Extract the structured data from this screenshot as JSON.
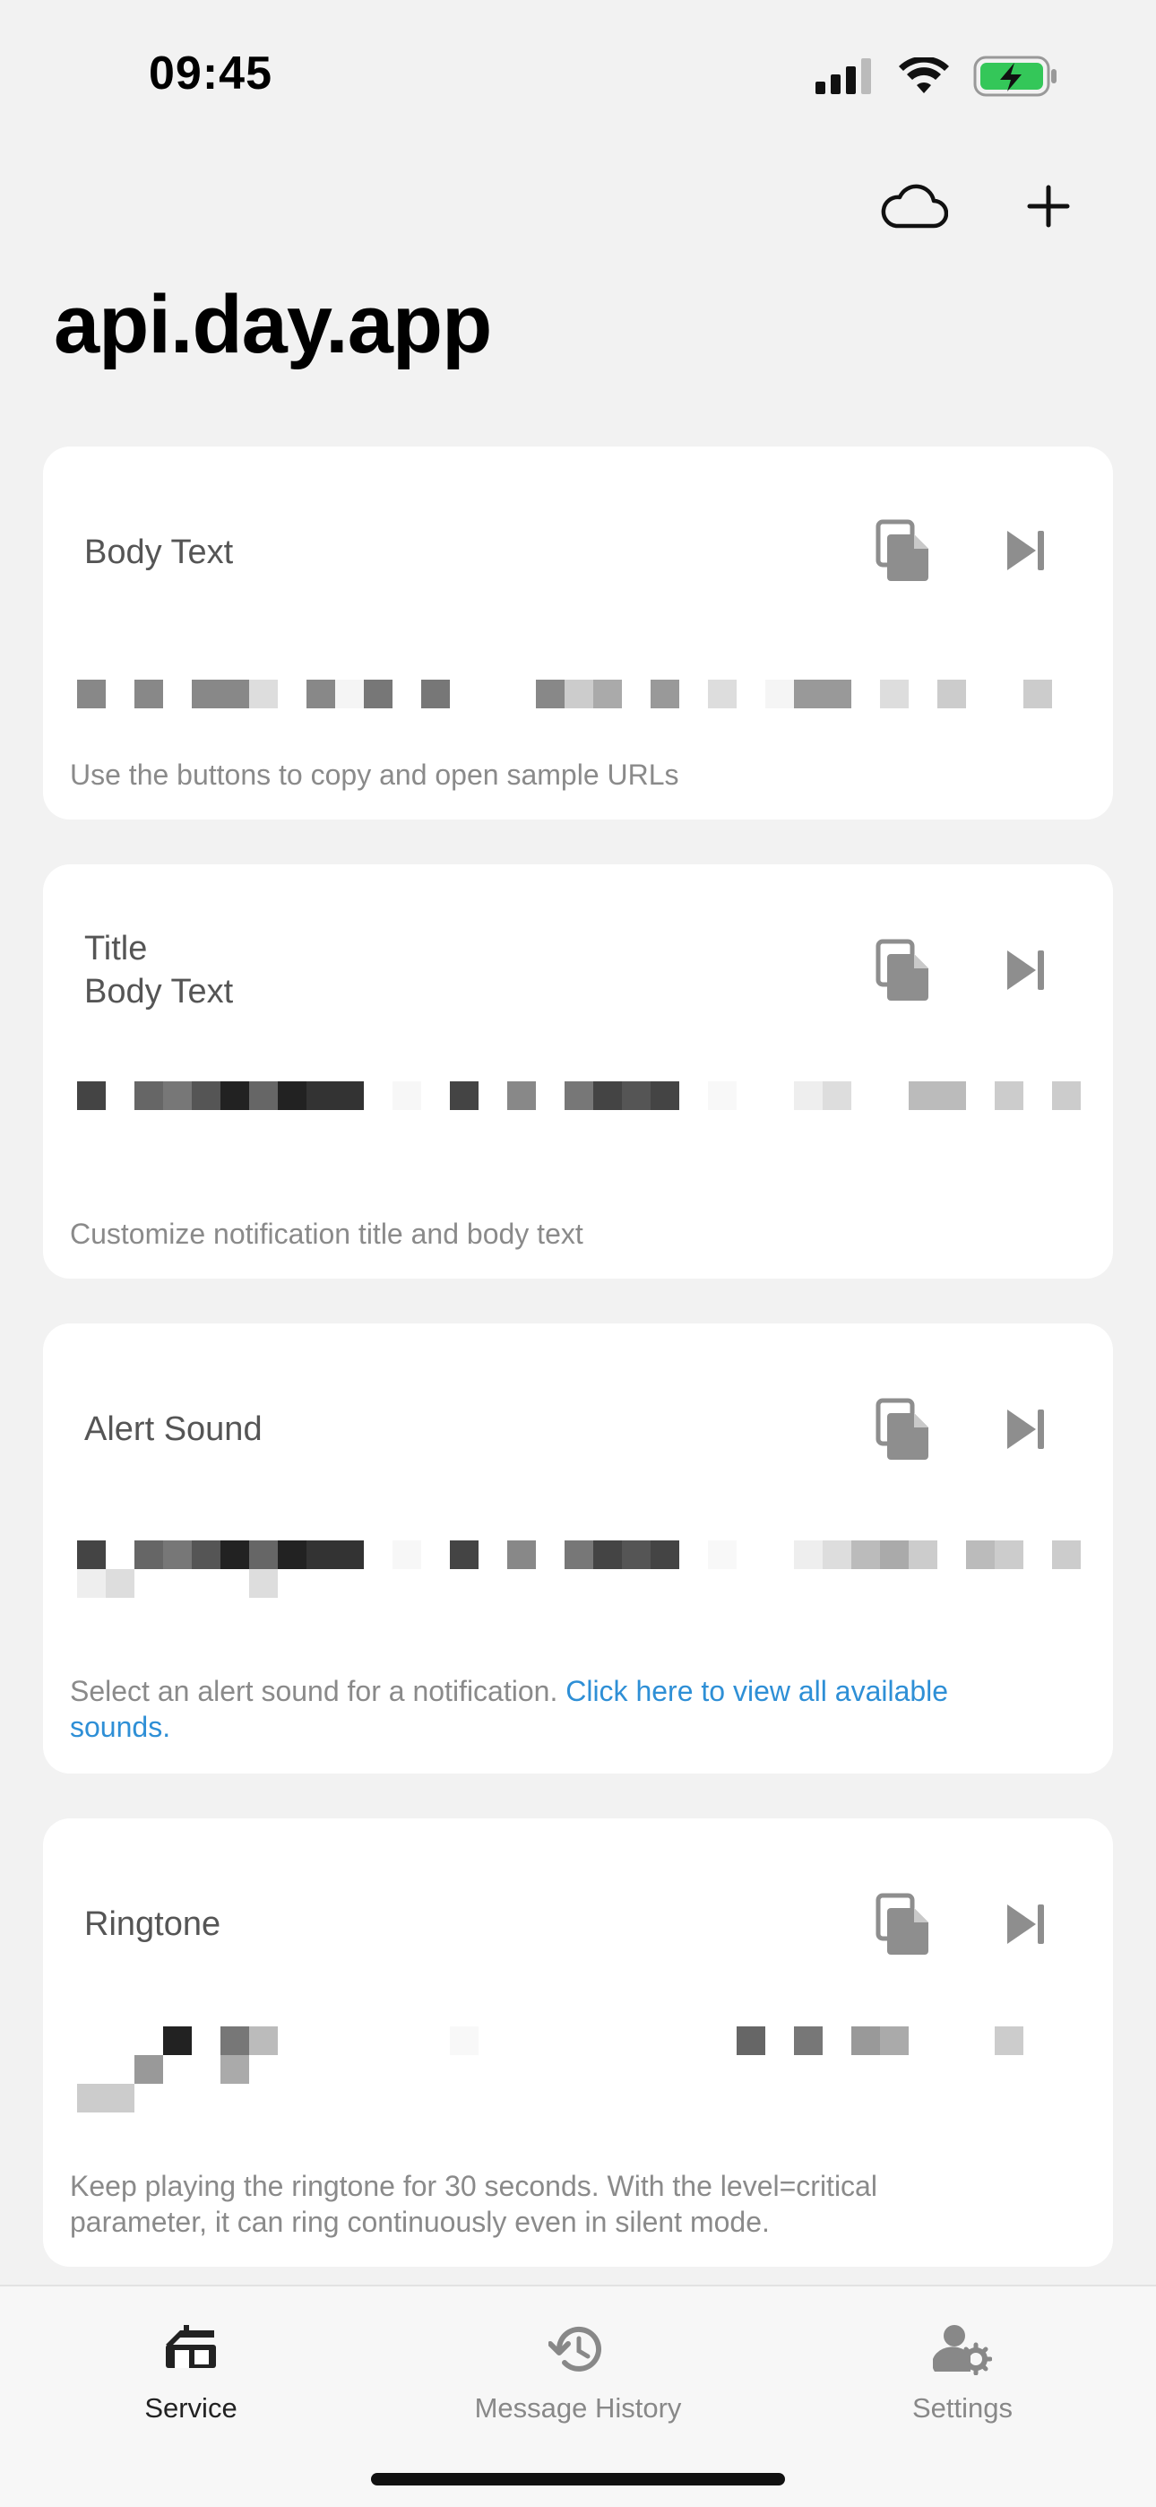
{
  "status": {
    "time": "09:45"
  },
  "icons": {
    "signal": "cellular-signal-icon",
    "wifi": "wifi-icon",
    "battery": "battery-charging-icon",
    "cloud": "cloud-icon",
    "add": "plus-icon",
    "copy": "copy-icon",
    "play": "play-next-icon"
  },
  "header": {
    "title": "api.day.app"
  },
  "cards": [
    {
      "title": "Body Text",
      "description": "Use the buttons to copy and open sample URLs",
      "link": ""
    },
    {
      "title": "Title\nBody Text",
      "description": "Customize notification title and body text",
      "link": ""
    },
    {
      "title": "Alert Sound",
      "description": "Select an alert sound for a notification.  ",
      "link": "Click here to view all available sounds."
    },
    {
      "title": "Ringtone",
      "description": "Keep playing the ringtone for 30 seconds. With the level=critical parameter, it can ring continuously even in silent mode.",
      "link": ""
    }
  ],
  "tabs": [
    {
      "label": "Service",
      "icon": "service-icon",
      "active": true
    },
    {
      "label": "Message History",
      "icon": "history-icon",
      "active": false
    },
    {
      "label": "Settings",
      "icon": "user-gear-icon",
      "active": false
    }
  ],
  "colors": {
    "background": "#f2f2f2",
    "card": "#ffffff",
    "link": "#2e8fd6",
    "battery": "#34c759",
    "icon_gray": "#8e8e8e"
  }
}
